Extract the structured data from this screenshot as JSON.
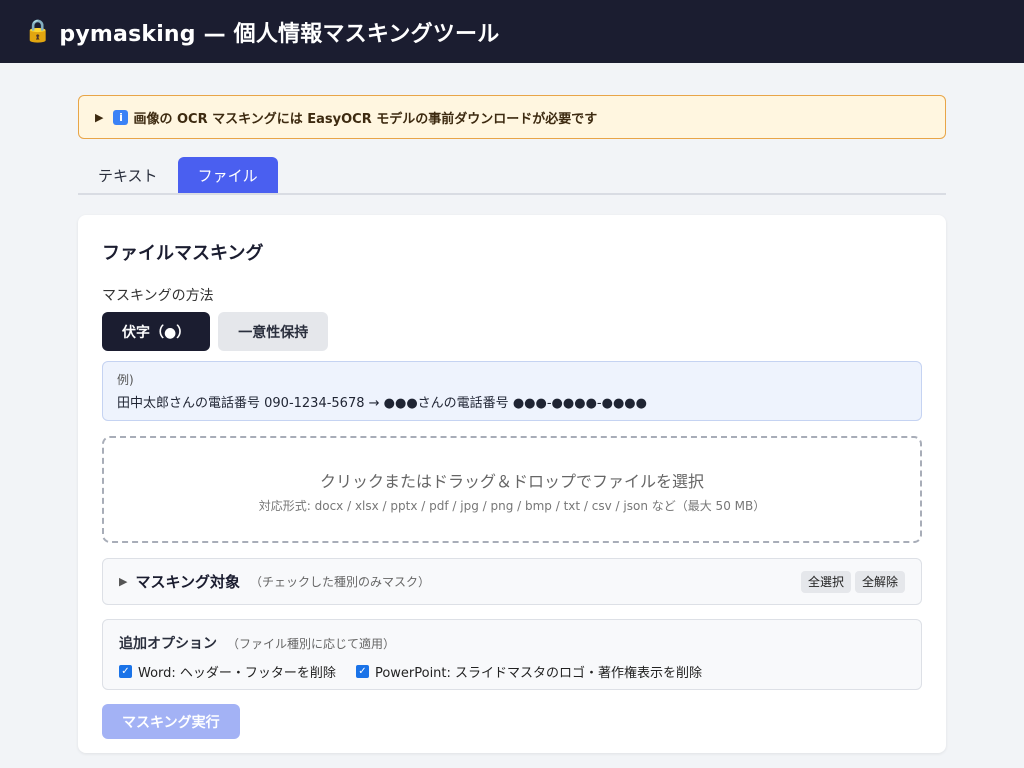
{
  "header": {
    "icon": "lock-icon",
    "title": "pymasking — 個人情報マスキングツール"
  },
  "notice": {
    "text": "画像の OCR マスキングには EasyOCR モデルの事前ダウンロードが必要です"
  },
  "tabs": [
    {
      "label": "テキスト",
      "active": false
    },
    {
      "label": "ファイル",
      "active": true
    }
  ],
  "card": {
    "title": "ファイルマスキング",
    "method_label": "マスキングの方法",
    "methods": [
      {
        "label": "伏字（●）",
        "selected": true
      },
      {
        "label": "一意性保持",
        "selected": false
      }
    ],
    "example": {
      "label": "例)",
      "text": "田中太郎さんの電話番号 090-1234-5678 → ●●●さんの電話番号 ●●●-●●●●-●●●●"
    },
    "dropzone": {
      "main": "クリックまたはドラッグ＆ドロップでファイルを選択",
      "sub": "対応形式: docx / xlsx / pptx / pdf / jpg / png / bmp / txt / csv / json など（最大 50 MB）"
    },
    "targets": {
      "title": "マスキング対象",
      "note": "（チェックした種別のみマスク）",
      "select_all": "全選択",
      "clear_all": "全解除"
    },
    "options": {
      "title": "追加オプション",
      "note": "（ファイル種別に応じて適用）",
      "items": [
        {
          "label": "Word: ヘッダー・フッターを削除",
          "checked": true
        },
        {
          "label": "PowerPoint: スライドマスタのロゴ・著作権表示を削除",
          "checked": true
        }
      ]
    },
    "run_button": "マスキング実行"
  },
  "colors": {
    "header_bg": "#1b1d30",
    "accent": "#4a5ff0",
    "notice_bg": "#fff6e0",
    "notice_border": "#e8a548",
    "run_button_disabled": "#a3b2f5"
  }
}
